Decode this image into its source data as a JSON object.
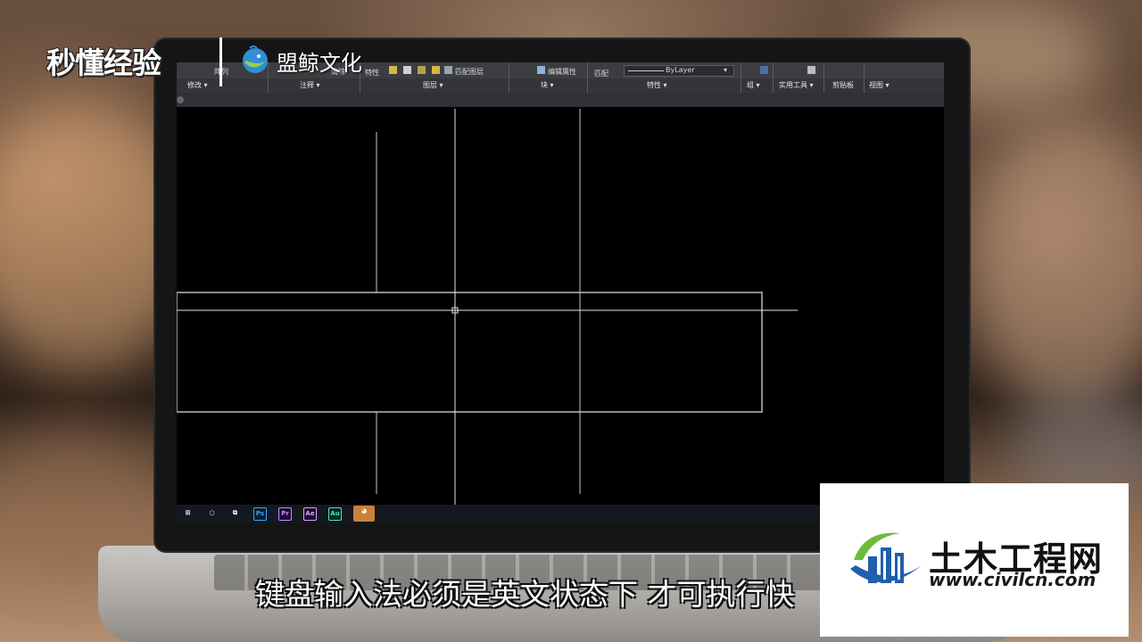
{
  "watermarks": {
    "miaodong": "秒懂经验",
    "mengjing": "盟鲸文化"
  },
  "ribbon": {
    "top_items": {
      "array": "阵列",
      "clear": "清除",
      "properties_btn": "特性",
      "match_layer": "匹配图层",
      "edit_attr": "编辑属性",
      "match": "匹配",
      "bylayer": "ByLayer"
    },
    "panel_labels": {
      "modify": "修改 ▾",
      "annotate": "注释 ▾",
      "layers": "图层 ▾",
      "block": "块 ▾",
      "properties": "特性 ▾",
      "group": "组 ▾",
      "utilities": "实用工具 ▾",
      "clipboard": "剪贴板",
      "view": "视图 ▾"
    }
  },
  "taskbar": {
    "apps": [
      "Ps",
      "Pr",
      "Ae",
      "Au"
    ]
  },
  "subtitle": "键盘输入法必须是英文状态下 才可执行快",
  "civil": {
    "title": "土木工程网",
    "url": "www.civilcn.com"
  },
  "colors": {
    "cad_lines": "#c8c8c8",
    "cad_rect": "#b4b0a6",
    "ribbon_bg": "#3b3d40",
    "civil_blue": "#1f5fae",
    "civil_green": "#6dbb3a"
  }
}
